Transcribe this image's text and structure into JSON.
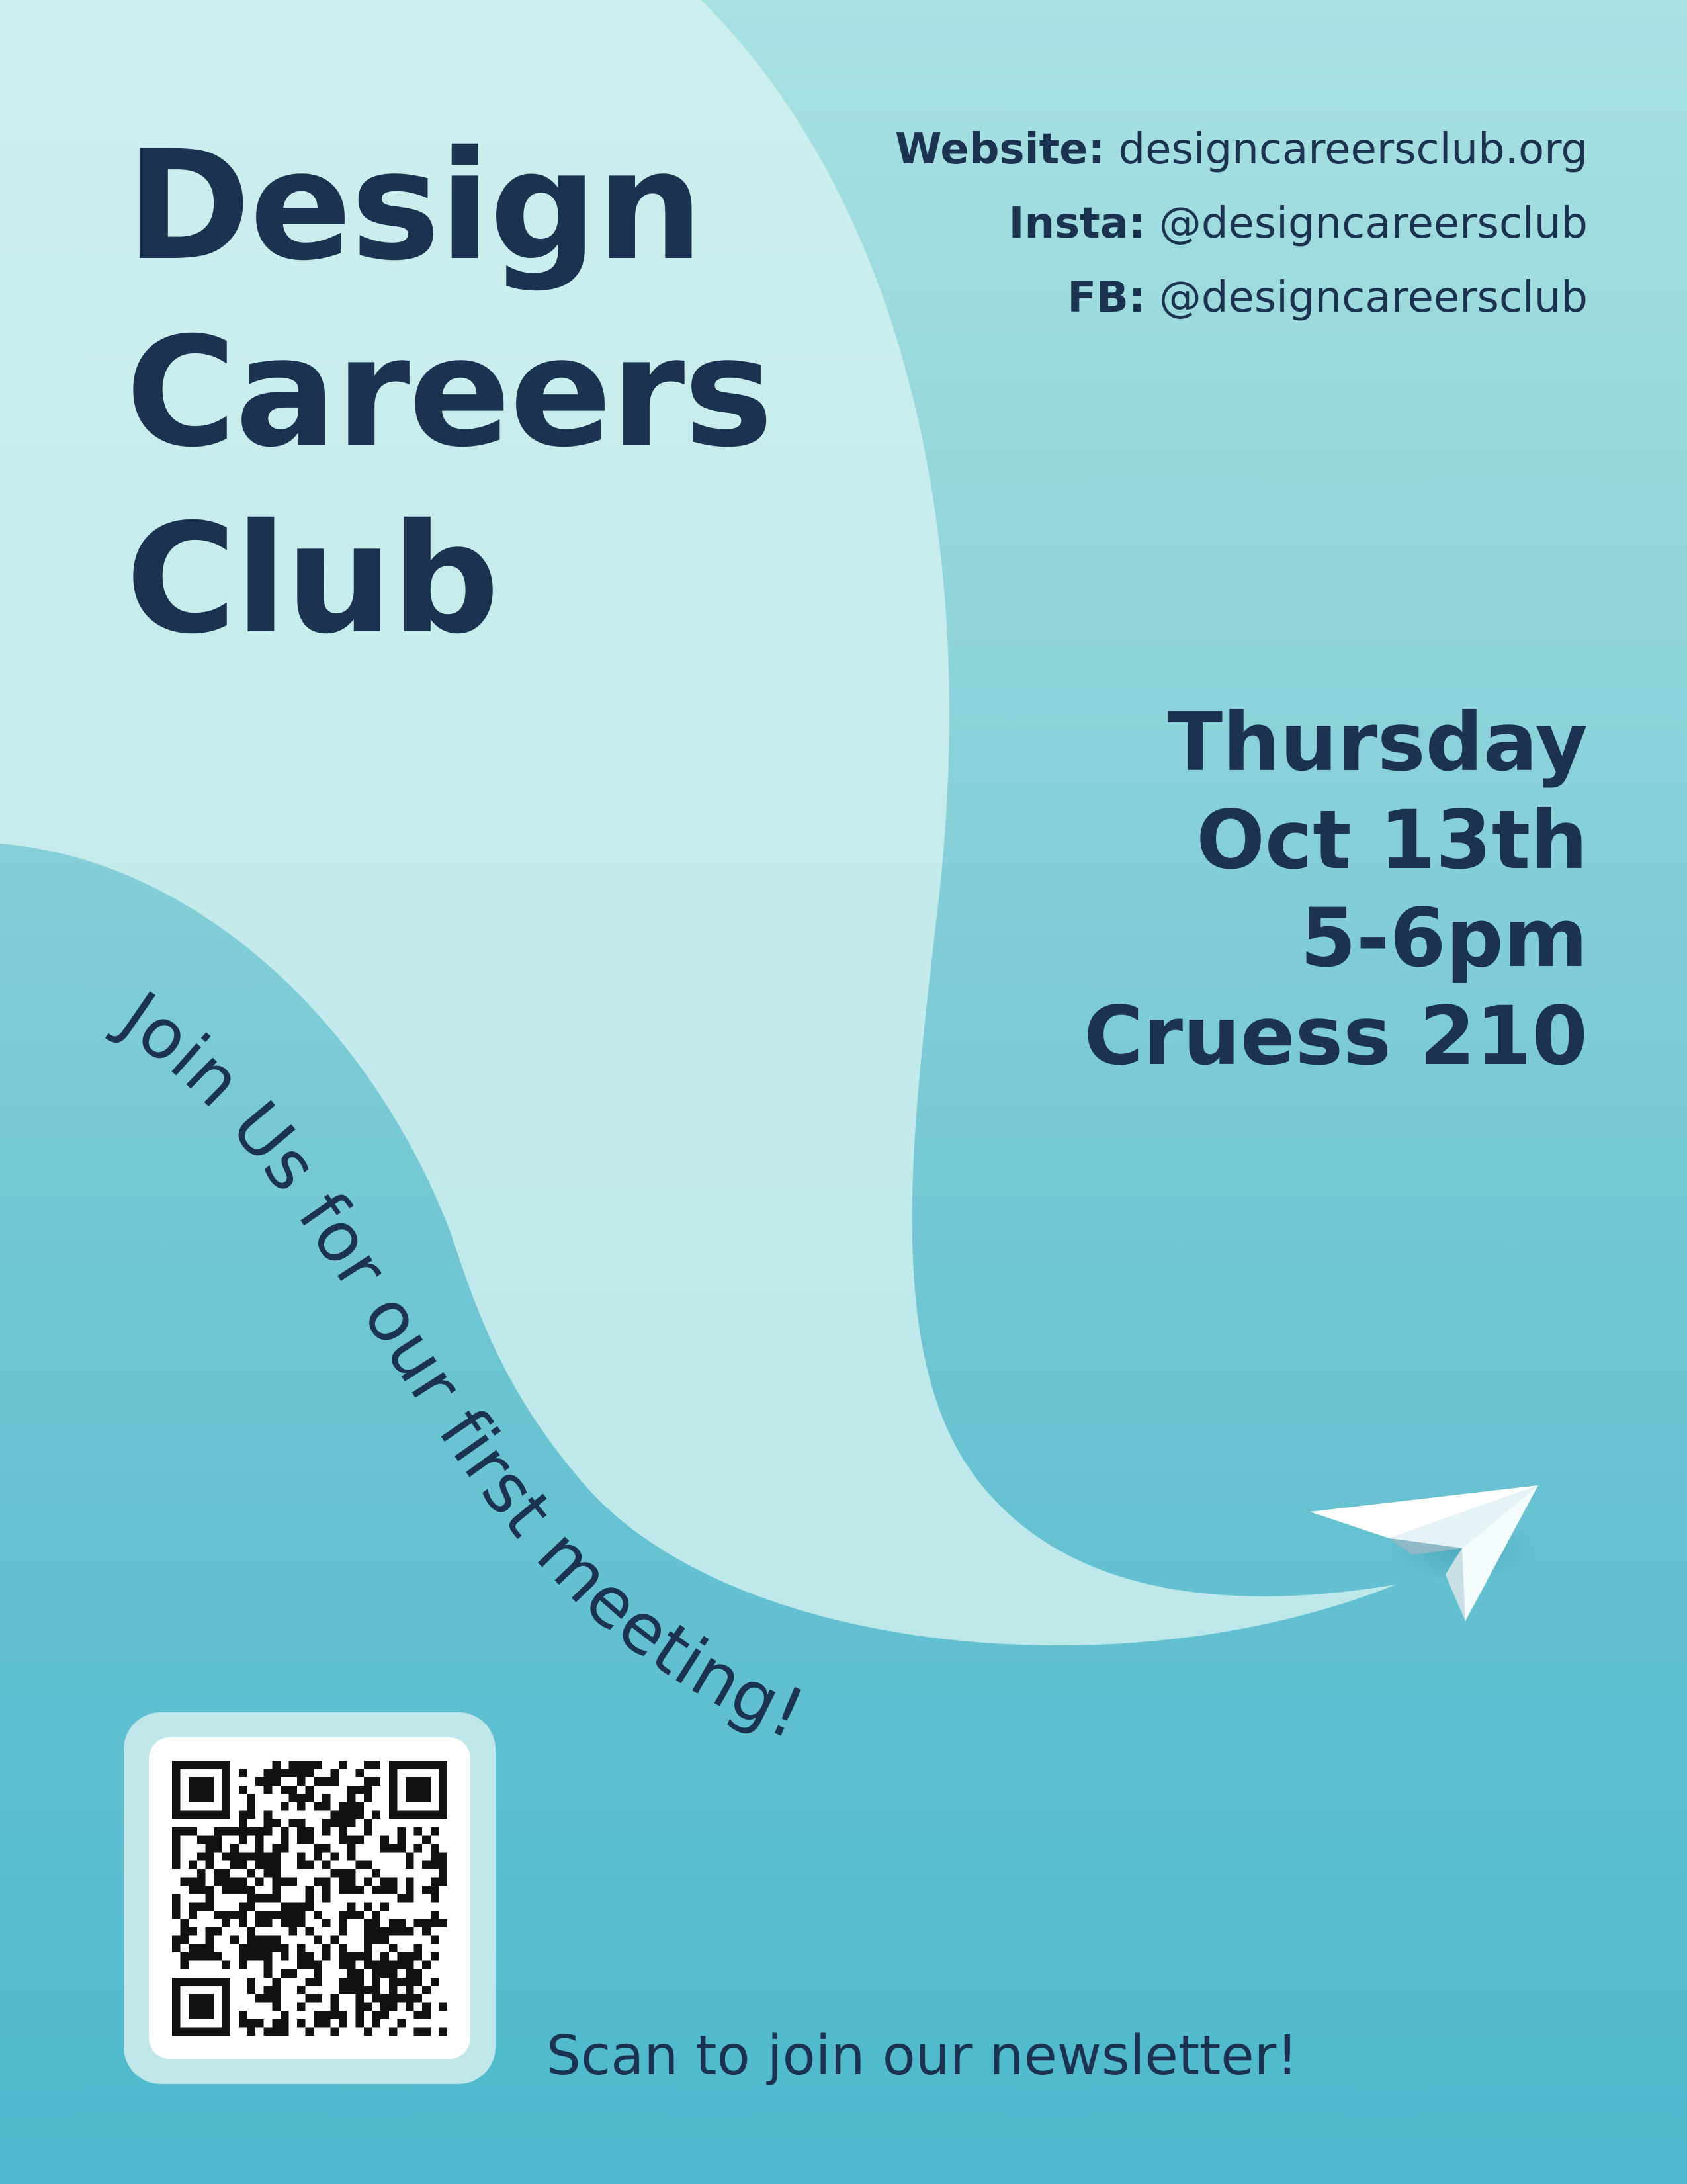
{
  "title": {
    "line1": "Design",
    "line2": "Careers",
    "line3": "Club"
  },
  "contacts": [
    {
      "label": "Website:",
      "value": "designcareersclub.org"
    },
    {
      "label": "Insta:",
      "value": "@designcareersclub"
    },
    {
      "label": "FB:",
      "value": "@designcareersclub"
    }
  ],
  "event": {
    "day": "Thursday",
    "date": "Oct 13th",
    "time": "5-6pm",
    "location": "Cruess 210"
  },
  "tagline": "Join Us for our first meeting!",
  "newsletter": "Scan to join our newsletter!",
  "colors": {
    "text": "#1b3350",
    "background_top": "#a8e1e2",
    "background_bottom": "#4db8cc",
    "swoosh": "#c6ebec",
    "qr_frame": "#bfe7ea"
  },
  "icons": [
    "paper-plane-icon",
    "qr-code"
  ]
}
